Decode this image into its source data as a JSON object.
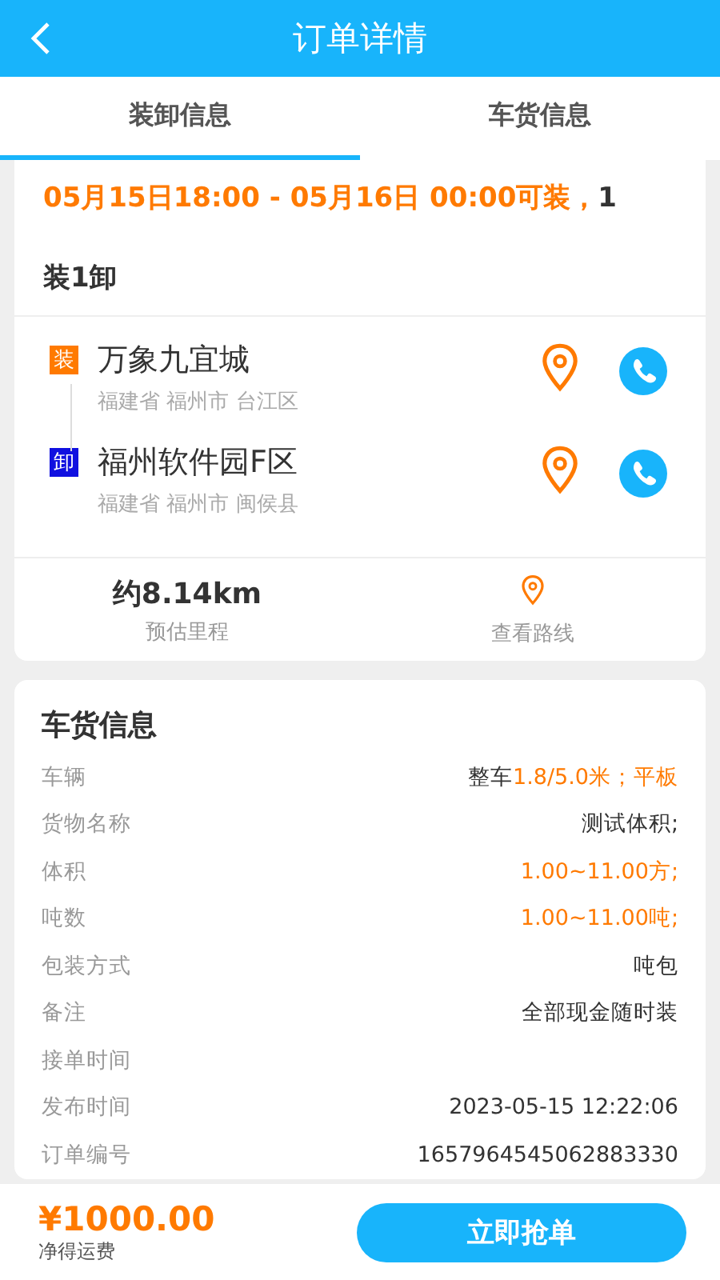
{
  "header": {
    "title": "订单详情"
  },
  "tabs": [
    {
      "label": "装卸信息",
      "selected": true
    },
    {
      "label": "车货信息",
      "selected": false
    }
  ],
  "schedule": {
    "time": "05月15日18:00 - 05月16日 00:00可装，",
    "count": "1",
    "summary": "装1卸"
  },
  "stops": [
    {
      "badge": "装",
      "color": "#ff7a00",
      "name": "万象九宜城",
      "address": "福建省 福州市 台江区"
    },
    {
      "badge": "卸",
      "color": "#1010e0",
      "name": "福州软件园F区",
      "address": "福建省 福州市 闽侯县"
    }
  ],
  "route": {
    "distance": "约8.14km",
    "distance_label": "预估里程",
    "route_label": "查看路线"
  },
  "cargo": {
    "title": "车货信息",
    "rows": [
      {
        "label": "车辆",
        "prefix": "整车",
        "value": "1.8/5.0米；平板",
        "highlight": true
      },
      {
        "label": "货物名称",
        "value": "测试体积;",
        "highlight": false
      },
      {
        "label": "体积",
        "value": "1.00~11.00方;",
        "highlight": true
      },
      {
        "label": "吨数",
        "value": "1.00~11.00吨;",
        "highlight": true
      },
      {
        "label": "包装方式",
        "value": "吨包",
        "highlight": false
      },
      {
        "label": "备注",
        "value": "全部现金随时装",
        "highlight": false
      },
      {
        "label": "接单时间"
      },
      {
        "label": "发布时间",
        "value": "2023-05-15 12:22:06",
        "highlight": false
      },
      {
        "label": "订单编号",
        "value": "1657964545062883330",
        "highlight": false
      }
    ]
  },
  "footer": {
    "price": "¥1000.00",
    "price_label": "净得运费",
    "button": "立即抢单"
  }
}
